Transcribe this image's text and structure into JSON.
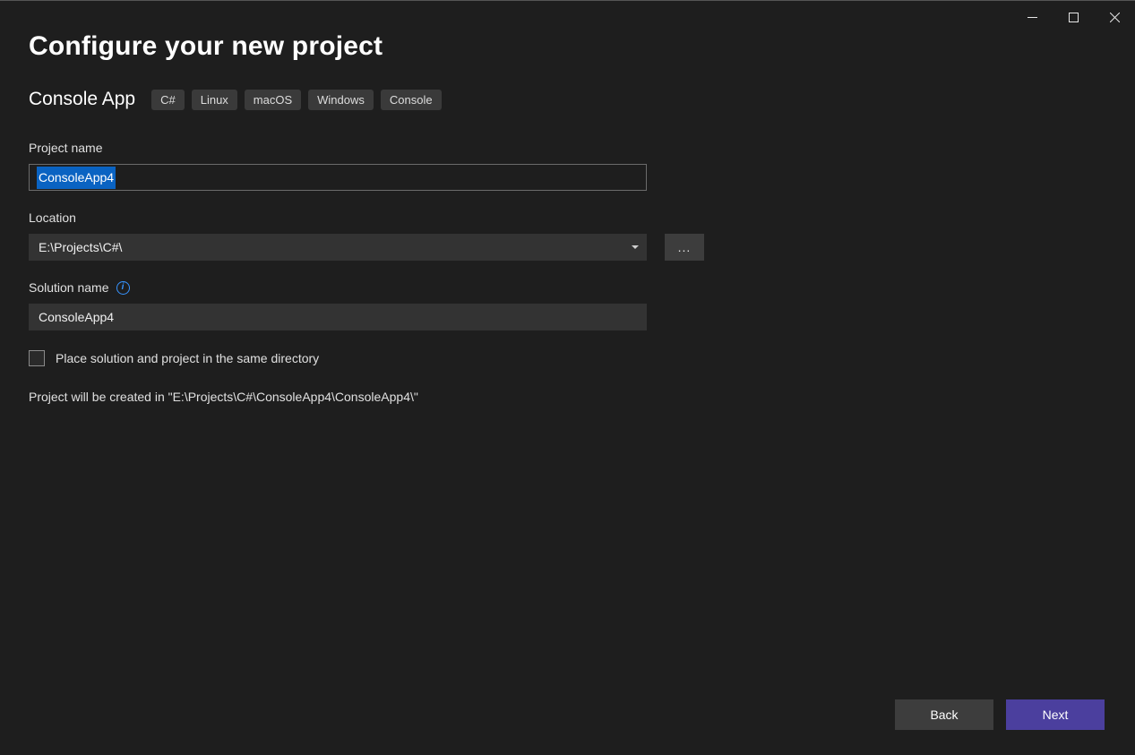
{
  "window": {
    "minimize_icon": "minimize-icon",
    "maximize_icon": "maximize-icon",
    "close_icon": "close-icon"
  },
  "page_title": "Configure your new project",
  "template": {
    "name": "Console App",
    "tags": [
      "C#",
      "Linux",
      "macOS",
      "Windows",
      "Console"
    ]
  },
  "project_name": {
    "label": "Project name",
    "value": "ConsoleApp4"
  },
  "location": {
    "label": "Location",
    "value": "E:\\Projects\\C#\\",
    "browse_label": "..."
  },
  "solution_name": {
    "label": "Solution name",
    "info_icon": "info-icon",
    "value": "ConsoleApp4"
  },
  "same_directory": {
    "checked": false,
    "label": "Place solution and project in the same directory"
  },
  "creation_path_text": "Project will be created in \"E:\\Projects\\C#\\ConsoleApp4\\ConsoleApp4\\\"",
  "footer": {
    "back_label": "Back",
    "next_label": "Next"
  }
}
